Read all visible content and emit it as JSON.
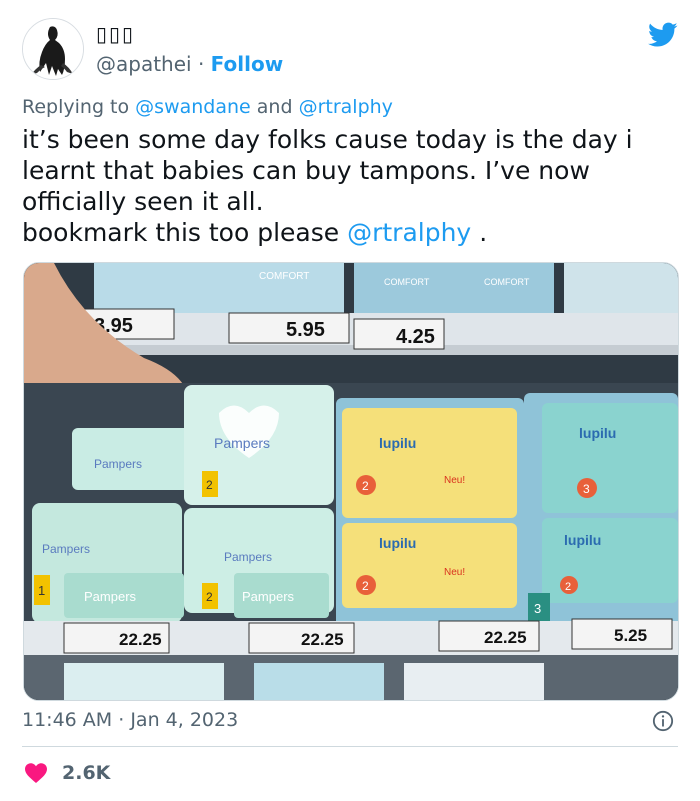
{
  "header": {
    "display_name": "▯▯▯",
    "handle": "@apathei",
    "separator": "·",
    "follow_label": "Follow"
  },
  "reply": {
    "prefix": "Replying to",
    "mention1": "@swandane",
    "conj": "and",
    "mention2": "@rtralphy"
  },
  "tweet": {
    "line1": "it’s been some day folks cause today is the day i learnt that babies can buy tampons. I’ve now officially seen it all.",
    "line2_text": "bookmark this too please",
    "line2_mention": "@rtralphy",
    "line2_end": "."
  },
  "photo": {
    "prices_top": [
      "3.95",
      "5.95",
      "4.25"
    ],
    "prices_bottom": [
      "22.25",
      "22.25",
      "22.25",
      "5.25"
    ],
    "brand_left": "Pampers",
    "brand_right": "lupilu",
    "label_comfort": "COMFORT",
    "size_badges": [
      "1",
      "2",
      "2",
      "2",
      "3",
      "2",
      "2",
      "3"
    ],
    "neu_label": "Neu!"
  },
  "footer": {
    "time": "11:46 AM",
    "sep": "·",
    "date": "Jan 4, 2023",
    "likes": "2.6K"
  },
  "colors": {
    "brand_blue": "#1d9bf0",
    "like_red": "#f91880",
    "secondary_text": "#536471"
  },
  "icons": [
    "twitter-bird-icon",
    "info-icon",
    "heart-icon"
  ]
}
